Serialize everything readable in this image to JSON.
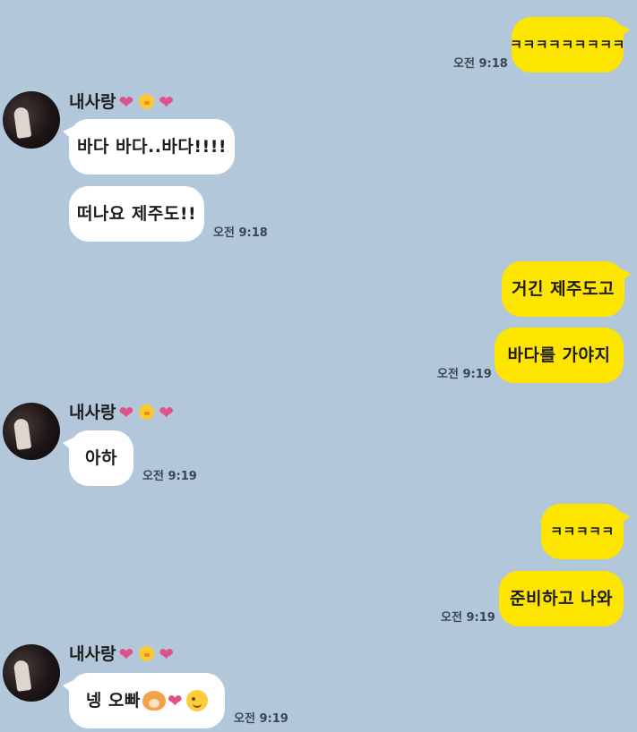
{
  "contact": {
    "name": "내사랑"
  },
  "messages": {
    "m1": {
      "text": "ㅋㅋㅋㅋㅋㅋㅋㅋㅋ",
      "time": "오전 9:18"
    },
    "m2": {
      "text": "바다 바다..바다!!!!"
    },
    "m3": {
      "text": "떠나요 제주도!!",
      "time": "오전 9:18"
    },
    "m4": {
      "text": "거긴 제주도고"
    },
    "m5": {
      "text": "바다를 가야지",
      "time": "오전 9:19"
    },
    "m6": {
      "text": "아하",
      "time": "오전 9:19"
    },
    "m7": {
      "text": "ㅋㅋㅋㅋㅋ"
    },
    "m8": {
      "text": "준비하고 나와",
      "time": "오전 9:19"
    },
    "m9": {
      "text": "넹 오빠",
      "time": "오전 9:19"
    }
  },
  "colors": {
    "background": "#b2c7da",
    "mine": "#fee500",
    "theirs": "#ffffff",
    "heart": "#e0518c"
  },
  "icons": [
    "heart-icon",
    "chick-icon",
    "hamster-icon",
    "wink-face-icon"
  ]
}
